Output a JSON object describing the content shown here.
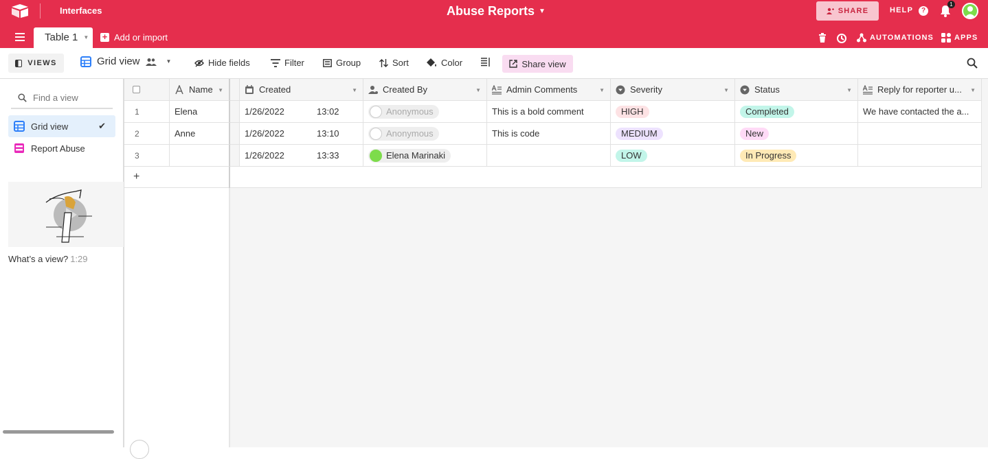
{
  "topbar": {
    "interfaces_label": "Interfaces",
    "base_title": "Abuse Reports",
    "share_label": "SHARE",
    "help_label": "HELP",
    "notification_count": "1",
    "table_tab_label": "Table 1",
    "add_import_label": "Add or import",
    "automations_label": "AUTOMATIONS",
    "apps_label": "APPS",
    "brand_color": "#e52e4d"
  },
  "viewbar": {
    "views_label": "VIEWS",
    "current_view": "Grid view",
    "hide_fields": "Hide fields",
    "filter": "Filter",
    "group": "Group",
    "sort": "Sort",
    "color": "Color",
    "share_view": "Share view"
  },
  "sidebar": {
    "find_placeholder": "Find a view",
    "views": [
      {
        "label": "Grid view",
        "icon": "grid-icon",
        "active": true
      },
      {
        "label": "Report Abuse",
        "icon": "form-icon",
        "active": false
      }
    ],
    "video_caption": "What’s a view?",
    "video_duration": "1:29"
  },
  "table": {
    "columns": [
      {
        "label": "Name",
        "icon": "text-field-icon"
      },
      {
        "label": "Created",
        "icon": "created-time-icon"
      },
      {
        "label": "Created By",
        "icon": "created-by-icon"
      },
      {
        "label": "Admin Comments",
        "icon": "long-text-icon"
      },
      {
        "label": "Severity",
        "icon": "single-select-icon"
      },
      {
        "label": "Status",
        "icon": "single-select-icon"
      },
      {
        "label": "Reply for reporter u...",
        "icon": "long-text-icon"
      }
    ],
    "rows": [
      {
        "num": "1",
        "name": "Elena",
        "date": "1/26/2022",
        "time": "13:02",
        "created_by": "Anonymous",
        "admin": "This is a bold comment",
        "severity": "HIGH",
        "status": "Completed",
        "reply": "We have contacted the a..."
      },
      {
        "num": "2",
        "name": "Anne",
        "date": "1/26/2022",
        "time": "13:10",
        "created_by": "Anonymous",
        "admin": "This is code",
        "severity": "MEDIUM",
        "status": "New",
        "reply": ""
      },
      {
        "num": "3",
        "name": "",
        "date": "1/26/2022",
        "time": "13:33",
        "created_by": "Elena Marinaki",
        "admin": "",
        "severity": "LOW",
        "status": "In Progress",
        "reply": ""
      }
    ],
    "add_row_label": "+",
    "severity_colors": {
      "HIGH": "#fde2e4",
      "MEDIUM": "#ede2fe",
      "LOW": "#c2f5e9"
    },
    "status_colors": {
      "Completed": "#c2f5e9",
      "New": "#ffdaf6",
      "In Progress": "#ffeab6"
    }
  }
}
